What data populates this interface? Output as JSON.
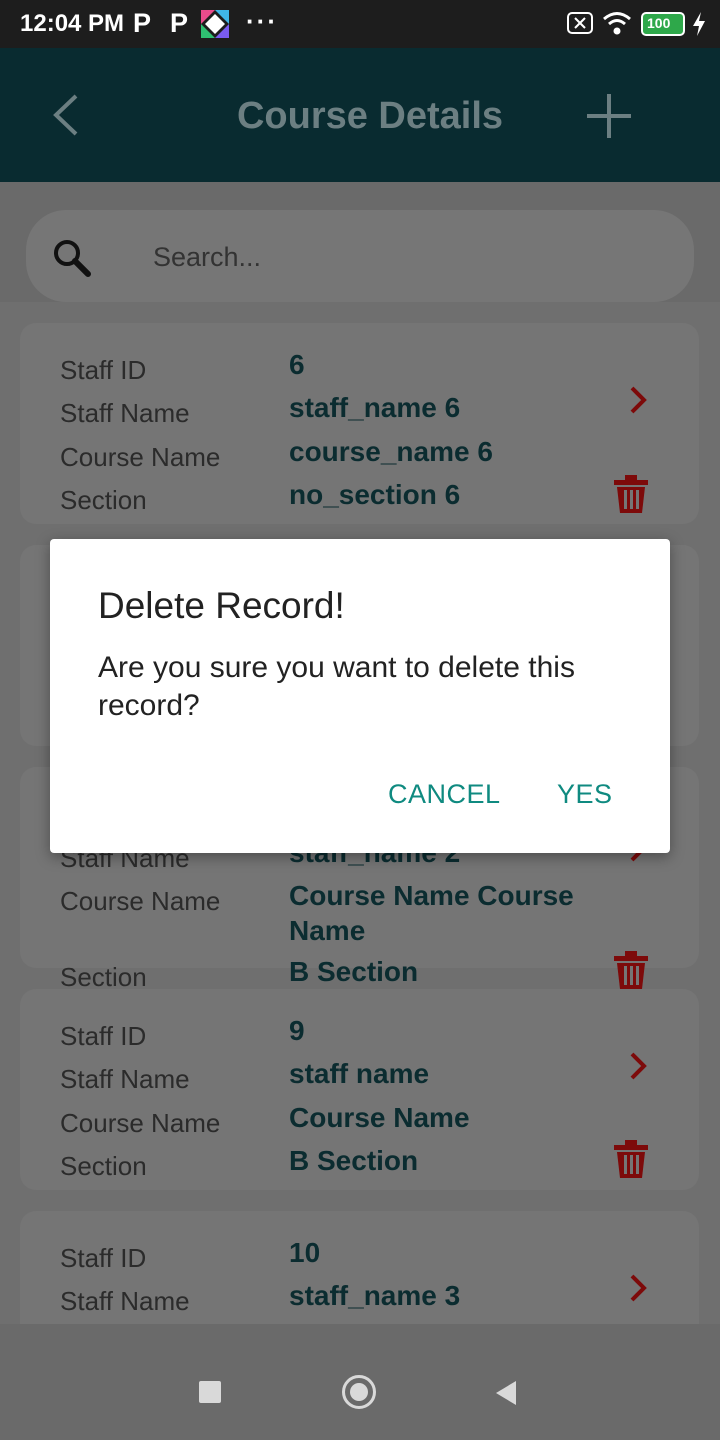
{
  "status_bar": {
    "time": "12:04 PM",
    "notif_p1": "P",
    "notif_p2": "P",
    "more": "···",
    "battery": "100"
  },
  "app_bar": {
    "title": "Course Details"
  },
  "search": {
    "placeholder": "Search..."
  },
  "labels": {
    "staff_id": "Staff ID",
    "staff_name": "Staff Name",
    "course_name": "Course Name",
    "section": "Section"
  },
  "cards": [
    {
      "staff_id": "6",
      "staff_name": "staff_name 6",
      "course_name": "course_name 6",
      "section": "no_section 6"
    },
    {
      "staff_name": "staff_name 2",
      "course_name_line1": "Course Name Course",
      "course_name_line2": "Name",
      "section": "B Section"
    },
    {
      "staff_id": "9",
      "staff_name": "staff name",
      "course_name": "Course Name",
      "section": "B Section"
    },
    {
      "staff_id": "10",
      "staff_name": "staff_name 3"
    }
  ],
  "dialog": {
    "title": "Delete Record!",
    "message": "Are you sure you want to delete this record?",
    "cancel_label": "CANCEL",
    "yes_label": "YES"
  },
  "colors": {
    "app_bar": "#092b30",
    "accent": "#0f8a80",
    "delete_icon": "#7d0a0a",
    "chevron": "#7d0a0a"
  }
}
